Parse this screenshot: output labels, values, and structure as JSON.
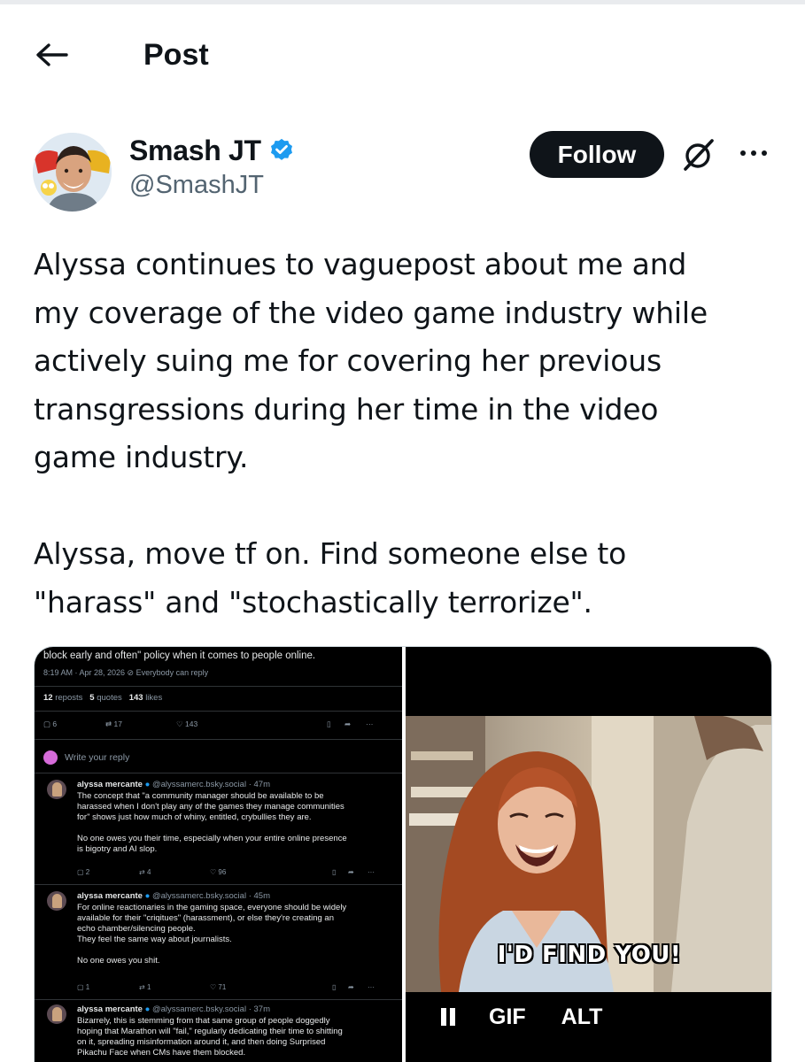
{
  "header": {
    "title": "Post"
  },
  "author": {
    "name": "Smash JT",
    "handle": "@SmashJT"
  },
  "actions": {
    "follow_label": "Follow"
  },
  "post": {
    "paragraph1": [
      "Alyssa continues to vaguepost about me and",
      "my coverage of the video game industry while",
      "actively suing me for covering her previous",
      "transgressions during her time in the video",
      "game industry."
    ],
    "paragraph2": [
      "Alyssa, move tf on. Find someone else to",
      "\"harass\" and \"stochastically  terrorize\"."
    ]
  },
  "screenshot": {
    "top_text": "block early and often\" policy when it comes to people online.",
    "meta": "8:19 AM · Apr 28, 2026  ⊘ Everybody can reply",
    "reposts_count": "12",
    "reposts_label": "reposts",
    "quotes_count": "5",
    "quotes_label": "quotes",
    "likes_count": "143",
    "likes_label": "likes",
    "action_counts": {
      "replies": "6",
      "reposts": "17",
      "likes": "143"
    },
    "reply_placeholder": "Write your reply",
    "replies": [
      {
        "name": "alyssa mercante",
        "handle_time": "@alyssamerc.bsky.social · 47m",
        "lines": [
          "The concept that \"a community manager should be available to be",
          "harassed when I don't play any of the games they manage communities",
          "for\" shows just how much of whiny, entitled, crybullies they are.",
          "",
          "No one owes you their time, especially when your entire online presence",
          "is bigotry and AI slop."
        ],
        "counts": {
          "replies": "2",
          "reposts": "4",
          "likes": "96"
        }
      },
      {
        "name": "alyssa mercante",
        "handle_time": "@alyssamerc.bsky.social · 45m",
        "lines": [
          "For online reactionaries in the gaming space, everyone should be widely",
          "available for their \"criqitues\" (harassment), or else they're creating an",
          "echo chamber/silencing people.",
          "They feel the same way about journalists.",
          "",
          "No one owes you shit."
        ],
        "counts": {
          "replies": "1",
          "reposts": "1",
          "likes": "71"
        }
      },
      {
        "name": "alyssa mercante",
        "handle_time": "@alyssamerc.bsky.social · 37m",
        "lines": [
          "Bizarrely, this is stemming from that same group of people doggedly",
          "hoping that Marathon will \"fail,\" regularly dedicating their time to shitting",
          "on it, spreading misinformation around it, and then doing Surprised",
          "Pikachu Face when CMs have them blocked."
        ],
        "counts": {
          "replies": "",
          "reposts": "",
          "likes": ""
        }
      }
    ]
  },
  "gif": {
    "caption": "I'D FIND YOU!",
    "gif_label": "GIF",
    "alt_label": "ALT"
  },
  "colors": {
    "text": "#0f1419",
    "secondary": "#536471",
    "verified": "#1d9bf0",
    "follow_bg": "#0f1419"
  },
  "icons": [
    "back-arrow-icon",
    "verified-badge-icon",
    "grok-icon",
    "more-icon",
    "pause-icon"
  ]
}
